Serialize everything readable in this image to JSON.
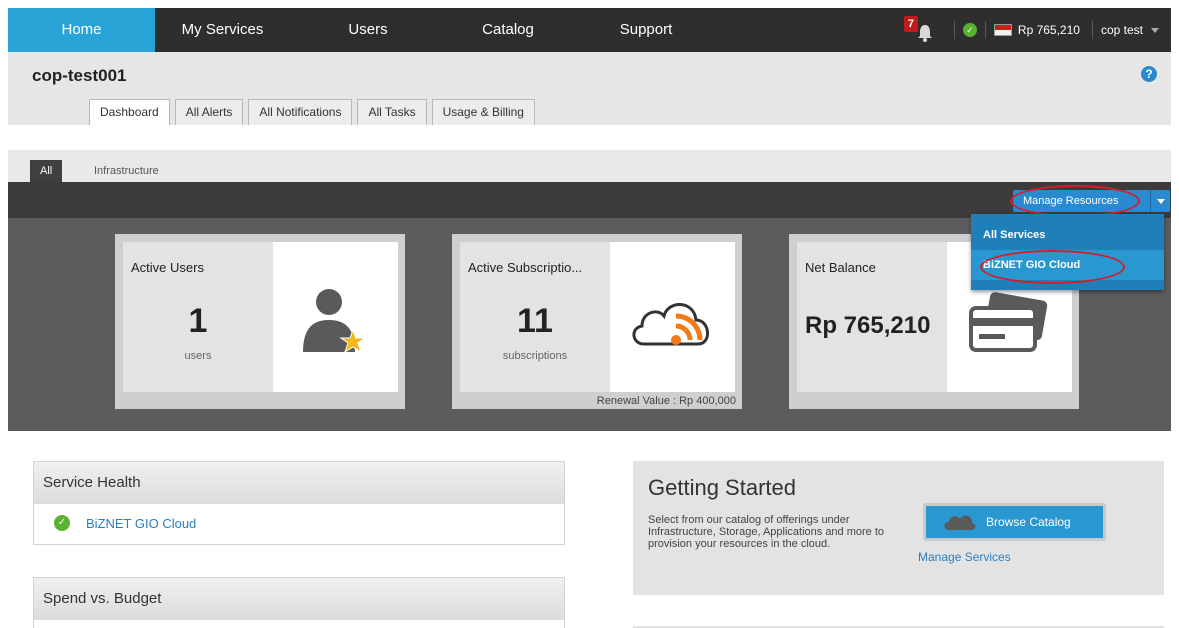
{
  "nav": {
    "items": [
      "Home",
      "My Services",
      "Users",
      "Catalog",
      "Support"
    ],
    "alert_count": "7",
    "balance": "Rp 765,210",
    "user": "cop test"
  },
  "header": {
    "account_name": "cop-test001",
    "tabs": [
      "Dashboard",
      "All Alerts",
      "All Notifications",
      "All Tasks",
      "Usage & Billing"
    ]
  },
  "subtabs": [
    "All",
    "Infrastructure"
  ],
  "manage": {
    "label": "Manage Resources",
    "options": [
      "All Services",
      "BiZNET GIO Cloud"
    ]
  },
  "cards": {
    "users": {
      "title": "Active Users",
      "value": "1",
      "unit": "users"
    },
    "subs": {
      "title": "Active Subscriptio...",
      "value": "11",
      "unit": "subscriptions",
      "footer": "Renewal Value : Rp 400,000"
    },
    "balance": {
      "title": "Net Balance",
      "value": "Rp 765,210"
    }
  },
  "service_health": {
    "title": "Service Health",
    "service": "BiZNET GIO Cloud"
  },
  "spend": {
    "title": "Spend vs. Budget"
  },
  "getting_started": {
    "title": "Getting Started",
    "text": "Select from our catalog of offerings under Infrastructure, Storage, Applications and more to provision your resources in the cloud.",
    "button": "Browse Catalog",
    "link": "Manage Services"
  },
  "colors": {
    "accent": "#2aa3d6",
    "nav_bg": "#2e2e2e",
    "highlight_oval": "#d21f2a",
    "ok": "#5cb131"
  }
}
